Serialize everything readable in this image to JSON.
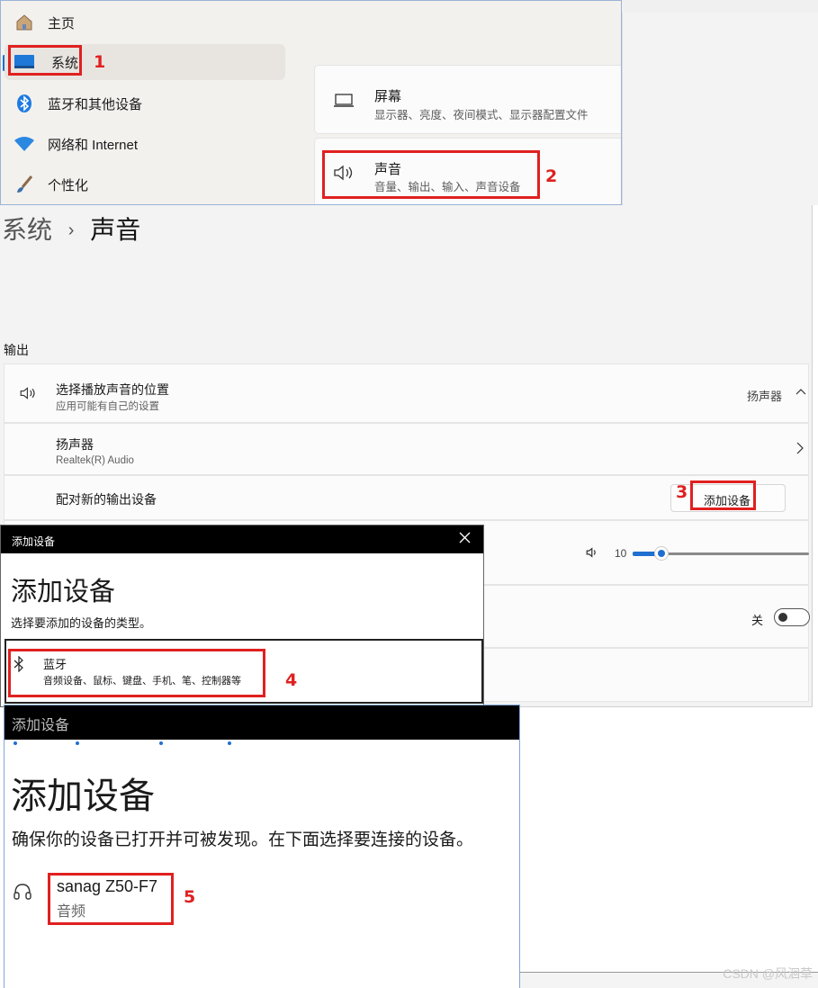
{
  "settings_nav": {
    "items": [
      {
        "label": "主页"
      },
      {
        "label": "系统"
      },
      {
        "label": "蓝牙和其他设备"
      },
      {
        "label": "网络和 Internet"
      },
      {
        "label": "个性化"
      }
    ]
  },
  "system_cards": {
    "screen": {
      "title": "屏幕",
      "subtitle": "显示器、亮度、夜间模式、显示器配置文件"
    },
    "sound": {
      "title": "声音",
      "subtitle": "音量、输出、输入、声音设备"
    }
  },
  "sound_page": {
    "breadcrumb_parent": "系统",
    "breadcrumb_sep": "›",
    "breadcrumb_current": "声音",
    "output_header": "输出",
    "choose_output": {
      "title": "选择播放声音的位置",
      "subtitle": "应用可能有自己的设置",
      "value": "扬声器"
    },
    "speaker": {
      "title": "扬声器",
      "subtitle": "Realtek(R) Audio"
    },
    "pair_new": {
      "title": "配对新的输出设备",
      "button": "添加设备"
    },
    "volume": {
      "value": "10",
      "level": 0.1
    },
    "mono_toggle": {
      "label": "关"
    }
  },
  "add_device_dialog": {
    "window_title": "添加设备",
    "heading": "添加设备",
    "prompt": "选择要添加的设备的类型。",
    "bluetooth": {
      "title": "蓝牙",
      "subtitle": "音频设备、鼠标、键盘、手机、笔、控制器等"
    }
  },
  "add_device_dialog2": {
    "window_title": "添加设备",
    "heading": "添加设备",
    "prompt": "确保你的设备已打开并可被发现。在下面选择要连接的设备。",
    "device": {
      "name": "sanag Z50-F7",
      "type": "音频"
    }
  },
  "annotations": [
    "1",
    "2",
    "3",
    "4",
    "5"
  ],
  "watermark": "CSDN @风洄草",
  "colors": {
    "accent": "#1f6fd0",
    "annotation": "#e02020"
  }
}
